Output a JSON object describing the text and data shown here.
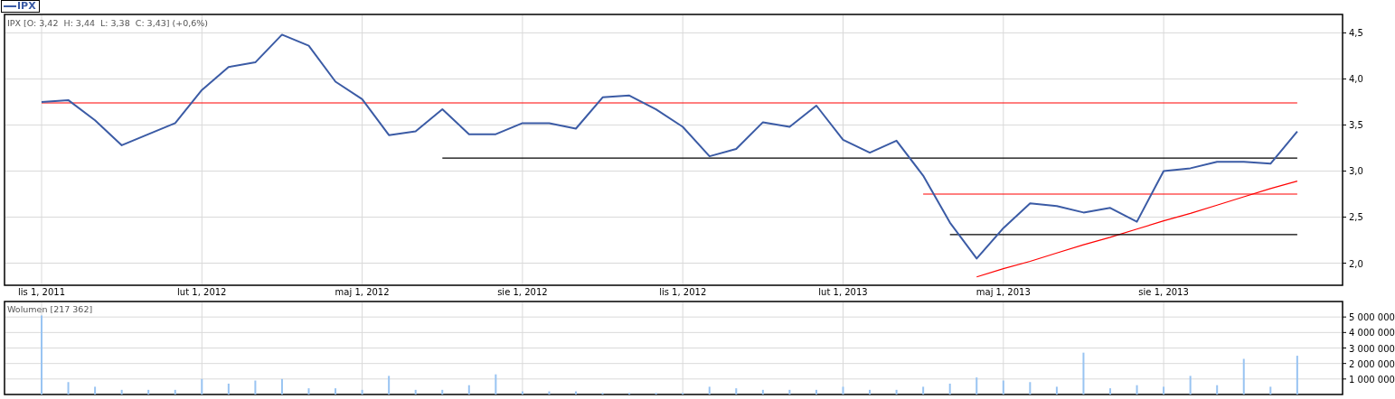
{
  "price_panel": {
    "info": "IPX [O: 3,42  H: 3,44  L: 3,38  C: 3,43] (+0,6%)",
    "chart_data": {
      "type": "line",
      "grid": true,
      "categories": [
        null,
        "lis 1, 2011",
        null,
        null,
        null,
        null,
        null,
        "lut 1, 2012",
        null,
        null,
        null,
        null,
        null,
        "maj 1, 2012",
        null,
        null,
        null,
        null,
        null,
        "sie 1, 2012",
        null,
        null,
        null,
        null,
        null,
        "lis 1, 2012",
        null,
        null,
        null,
        null,
        null,
        "lut 1, 2013",
        null,
        null,
        null,
        null,
        null,
        "maj 1, 2013",
        null,
        null,
        null,
        null,
        null,
        "sie 1, 2013",
        null,
        null,
        null,
        null,
        null
      ],
      "series": [
        {
          "name": "IPX",
          "color": "#3b5ba5",
          "values": [
            null,
            3.75,
            3.77,
            3.55,
            3.28,
            3.4,
            3.52,
            3.88,
            4.13,
            4.18,
            4.48,
            4.36,
            3.97,
            3.78,
            3.39,
            3.43,
            3.67,
            3.4,
            3.4,
            3.52,
            3.52,
            3.46,
            3.8,
            3.82,
            3.67,
            3.48,
            3.16,
            3.24,
            3.53,
            3.48,
            3.71,
            3.34,
            3.2,
            3.33,
            2.95,
            2.44,
            2.05,
            2.38,
            2.65,
            2.62,
            2.55,
            2.6,
            2.45,
            3.0,
            3.03,
            3.1,
            3.1,
            3.08,
            3.43
          ]
        },
        {
          "color": "#ff0000",
          "values": [
            null,
            3.74,
            3.74,
            3.74,
            3.74,
            3.74,
            3.74,
            3.74,
            3.74,
            3.74,
            3.74,
            3.74,
            3.74,
            3.74,
            3.74,
            3.74,
            3.74,
            3.74,
            3.74,
            3.74,
            3.74,
            3.74,
            3.74,
            3.74,
            3.74,
            3.74,
            3.74,
            3.74,
            3.74,
            3.74,
            3.74,
            3.74,
            3.74,
            3.74,
            3.74,
            3.74,
            3.74,
            3.74,
            3.74,
            3.74,
            3.74,
            3.74,
            3.74,
            3.74,
            3.74,
            3.74,
            3.74,
            3.74,
            3.74
          ]
        },
        {
          "color": "#000000",
          "values": [
            null,
            null,
            null,
            null,
            null,
            null,
            null,
            null,
            null,
            null,
            null,
            null,
            null,
            null,
            null,
            null,
            3.14,
            3.14,
            3.14,
            3.14,
            3.14,
            3.14,
            3.14,
            3.14,
            3.14,
            3.14,
            3.14,
            3.14,
            3.14,
            3.14,
            3.14,
            3.14,
            3.14,
            3.14,
            3.14,
            3.14,
            3.14,
            3.14,
            3.14,
            3.14,
            3.14,
            3.14,
            3.14,
            3.14,
            3.14,
            3.14,
            3.14,
            3.14,
            3.14
          ]
        },
        {
          "color": "#ff0000",
          "values": [
            null,
            null,
            null,
            null,
            null,
            null,
            null,
            null,
            null,
            null,
            null,
            null,
            null,
            null,
            null,
            null,
            null,
            null,
            null,
            null,
            null,
            null,
            null,
            null,
            null,
            null,
            null,
            null,
            null,
            null,
            null,
            null,
            null,
            null,
            2.75,
            2.75,
            2.75,
            2.75,
            2.75,
            2.75,
            2.75,
            2.75,
            2.75,
            2.75,
            2.75,
            2.75,
            2.75,
            2.75,
            2.75
          ]
        },
        {
          "color": "#000000",
          "values": [
            null,
            null,
            null,
            null,
            null,
            null,
            null,
            null,
            null,
            null,
            null,
            null,
            null,
            null,
            null,
            null,
            null,
            null,
            null,
            null,
            null,
            null,
            null,
            null,
            null,
            null,
            null,
            null,
            null,
            null,
            null,
            null,
            null,
            null,
            null,
            2.31,
            2.31,
            2.31,
            2.31,
            2.31,
            2.31,
            2.31,
            2.31,
            2.31,
            2.31,
            2.31,
            2.31,
            2.31,
            2.31
          ]
        },
        {
          "color": "#ff0000",
          "values": [
            null,
            null,
            null,
            null,
            null,
            null,
            null,
            null,
            null,
            null,
            null,
            null,
            null,
            null,
            null,
            null,
            null,
            null,
            null,
            null,
            null,
            null,
            null,
            null,
            null,
            null,
            null,
            null,
            null,
            null,
            null,
            null,
            null,
            null,
            null,
            null,
            1.85,
            1.94,
            2.02,
            2.11,
            2.2,
            2.28,
            2.37,
            2.46,
            2.54,
            2.63,
            2.72,
            2.81,
            2.89
          ]
        }
      ],
      "ylim": [
        1.76,
        4.7
      ],
      "yticks": [
        {
          "value": 2,
          "label": "2,0"
        },
        {
          "value": 2.5,
          "label": "2,5"
        },
        {
          "value": 3,
          "label": "3,0"
        },
        {
          "value": 3.5,
          "label": "3,5"
        },
        {
          "value": 4,
          "label": "4,0"
        },
        {
          "value": 4.5,
          "label": "4,5"
        }
      ]
    }
  },
  "volume_panel": {
    "info": "[217 362]",
    "chart_data": {
      "type": "bar",
      "grid": true,
      "series": [
        {
          "name": "Wolumen",
          "color": "#99c4f2",
          "values": [
            null,
            5100000,
            800000,
            500000,
            300000,
            300000,
            300000,
            1000000,
            700000,
            900000,
            1000000,
            400000,
            400000,
            300000,
            1200000,
            300000,
            300000,
            600000,
            1300000,
            200000,
            200000,
            200000,
            100000,
            100000,
            100000,
            100000,
            500000,
            400000,
            300000,
            300000,
            300000,
            500000,
            300000,
            300000,
            500000,
            700000,
            1100000,
            900000,
            800000,
            500000,
            2700000,
            400000,
            600000,
            500000,
            1200000,
            600000,
            2300000,
            500000,
            2500000
          ]
        }
      ],
      "ylim": [
        0,
        6000000
      ],
      "yticks": [
        {
          "value": 1000000,
          "label": "1 000 000"
        },
        {
          "value": 2000000,
          "label": "2 000 000"
        },
        {
          "value": 3000000,
          "label": "3 000 000"
        },
        {
          "value": 4000000,
          "label": "4 000 000"
        },
        {
          "value": 5000000,
          "label": "5 000 000"
        }
      ]
    }
  }
}
